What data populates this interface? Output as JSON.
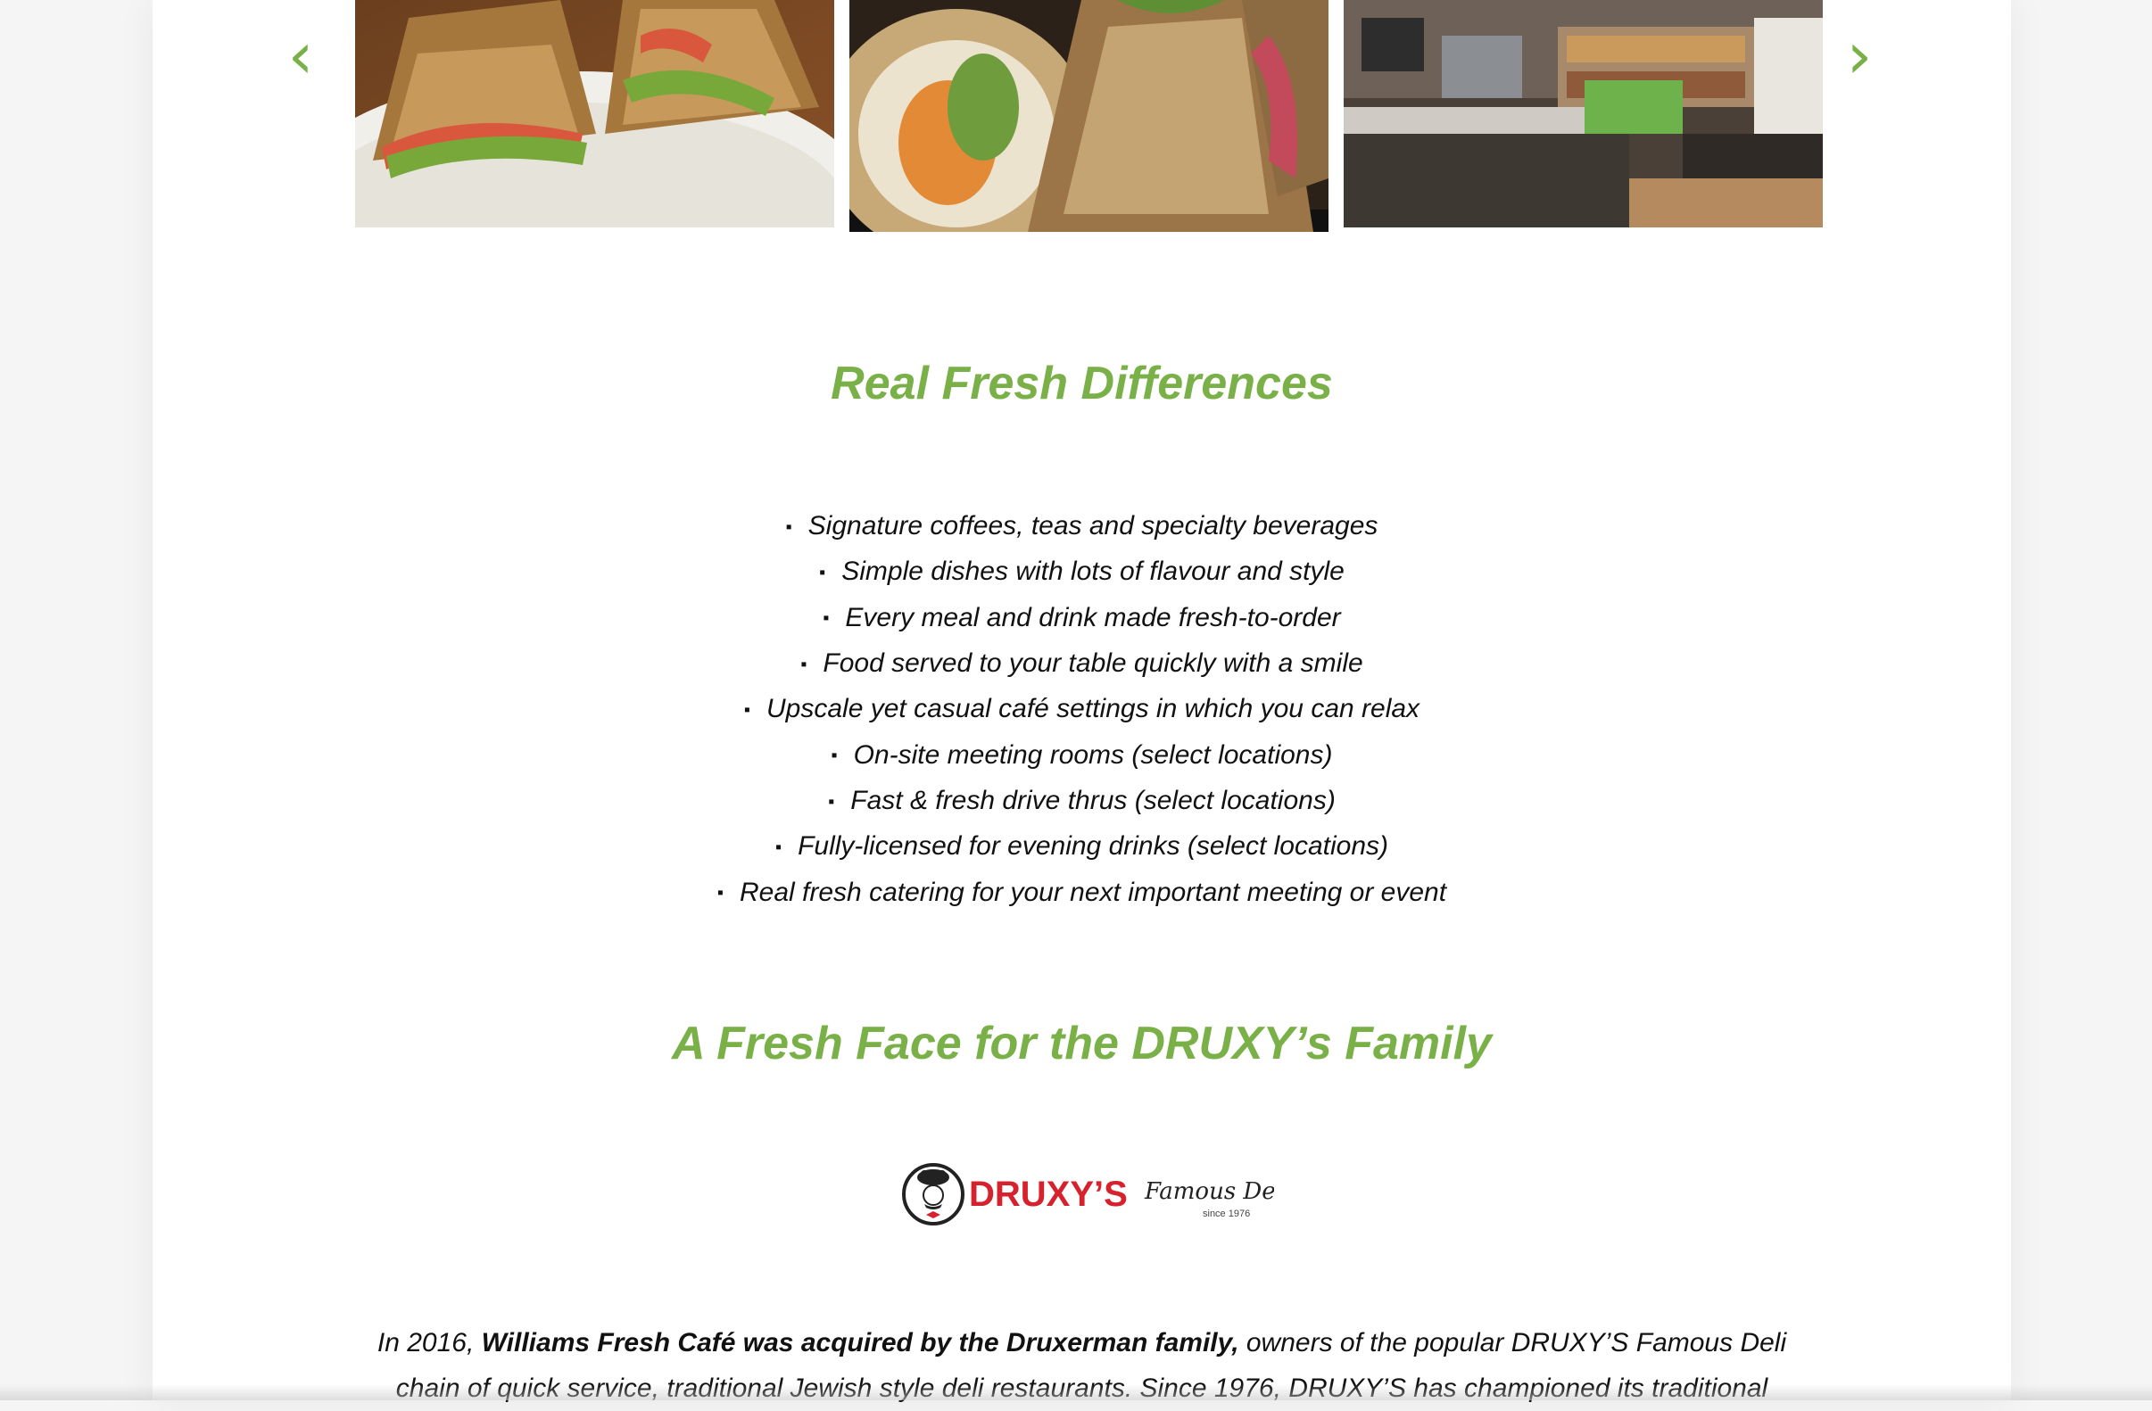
{
  "carousel": {
    "prev_icon": "chevron-left-icon",
    "next_icon": "chevron-right-icon",
    "prev_glyph": "‹",
    "next_glyph": "›",
    "slides": [
      {
        "subject": "sandwich-on-plate"
      },
      {
        "subject": "wrap-sandwich"
      },
      {
        "subject": "cafe-counter-interior"
      }
    ]
  },
  "section1": {
    "title": "Real Fresh Differences",
    "features": [
      "Signature coffees, teas and specialty beverages",
      "Simple dishes with lots of flavour and style",
      "Every meal and drink made fresh-to-order",
      "Food served to your table quickly with a smile",
      "Upscale yet casual café settings in which you can relax",
      "On-site meeting rooms (select locations)",
      "Fast & fresh drive thrus (select locations)",
      "Fully-licensed for evening drinks (select locations)",
      "Real fresh catering for your next important meeting or event"
    ]
  },
  "section2": {
    "title": "A Fresh Face for the DRUXY’s Family",
    "logo": {
      "brand": "DRUXY’S",
      "tagline": "Famous Deli",
      "since": "since 1976"
    },
    "paragraph": {
      "lead": "In 2016, ",
      "bold": "Williams Fresh Café was acquired by the Druxerman family,",
      "rest": " owners of the popular DRUXY’S Famous Deli chain of quick service, traditional Jewish style deli restaurants. Since 1976, DRUXY’S has championed its traditional"
    }
  },
  "colors": {
    "accent_green": "#79b047",
    "brand_red": "#d6222d",
    "text": "#111111"
  }
}
